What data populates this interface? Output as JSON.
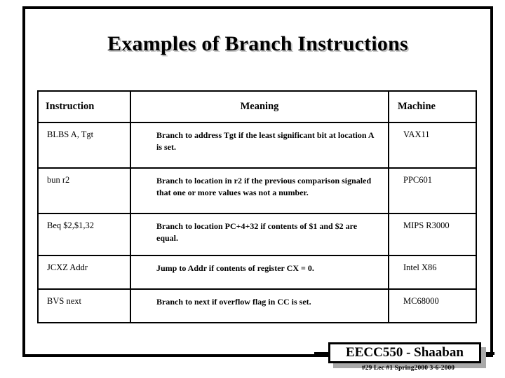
{
  "slide": {
    "title": "Examples of Branch Instructions"
  },
  "table": {
    "headers": {
      "instruction": "Instruction",
      "meaning": "Meaning",
      "machine": "Machine"
    },
    "rows": [
      {
        "instruction": "BLBS  A, Tgt",
        "meaning": "Branch to address Tgt if the least significant bit at location  A is set.",
        "machine": "VAX11"
      },
      {
        "instruction": "bun r2",
        "meaning": "Branch to location in r2 if the previous comparison signaled that one or more values was not a number.",
        "machine": "PPC601"
      },
      {
        "instruction": "Beq $2,$1,32",
        "meaning": "Branch to location PC+4+32 if contents of $1 and $2 are equal.",
        "machine": "MIPS R3000"
      },
      {
        "instruction": "JCXZ  Addr",
        "meaning": "Jump to Addr if contents of register CX = 0.",
        "machine": "Intel X86"
      },
      {
        "instruction": "BVS next",
        "meaning": "Branch to next if overflow flag in CC is set.",
        "machine": "MC68000"
      }
    ]
  },
  "footer": {
    "course_author": "EECC550 - Shaaban",
    "meta": "#29   Lec #1    Spring2000   3-6-2000"
  }
}
